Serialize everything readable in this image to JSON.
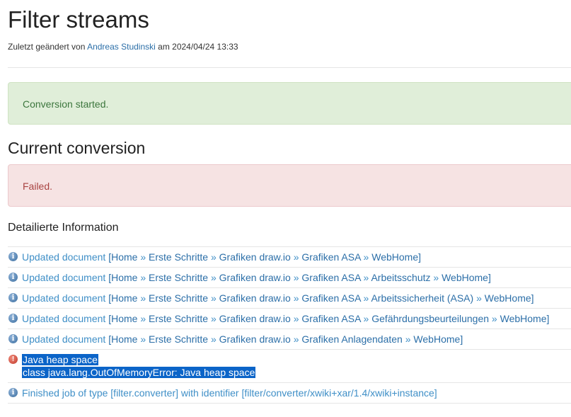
{
  "page": {
    "title": "Filter streams",
    "meta_prefix": "Zuletzt geändert von",
    "meta_author": "Andreas Studinski",
    "meta_suffix": "am 2024/04/24 13:33"
  },
  "alerts": {
    "success": "Conversion started.",
    "failed": "Failed."
  },
  "sections": {
    "current_conversion": "Current conversion",
    "details": "Detailierte Information"
  },
  "icons": {
    "info": "info-icon",
    "error": "error-icon",
    "info_color": "#3c6e9f",
    "error_color": "#c0392b"
  },
  "log": {
    "updated_label": "Updated document",
    "separator": "»",
    "doc1": [
      "Home",
      "Erste Schritte",
      "Grafiken draw.io",
      "Grafiken ASA",
      "WebHome"
    ],
    "doc2": [
      "Home",
      "Erste Schritte",
      "Grafiken draw.io",
      "Grafiken ASA",
      "Arbeitsschutz",
      "WebHome"
    ],
    "doc3": [
      "Home",
      "Erste Schritte",
      "Grafiken draw.io",
      "Grafiken ASA",
      "Arbeitssicherheit (ASA)",
      "WebHome"
    ],
    "doc4": [
      "Home",
      "Erste Schritte",
      "Grafiken draw.io",
      "Grafiken ASA",
      "Gefährdungsbeurteilungen",
      "WebHome"
    ],
    "doc5": [
      "Home",
      "Erste Schritte",
      "Grafiken draw.io",
      "Grafiken Anlagendaten",
      "WebHome"
    ],
    "error_line1": "Java heap space",
    "error_line2": "class java.lang.OutOfMemoryError: Java heap space",
    "finished": "Finished job of type [filter.converter] with identifier [filter/converter/xwiki+xar/1.4/xwiki+instance]"
  }
}
